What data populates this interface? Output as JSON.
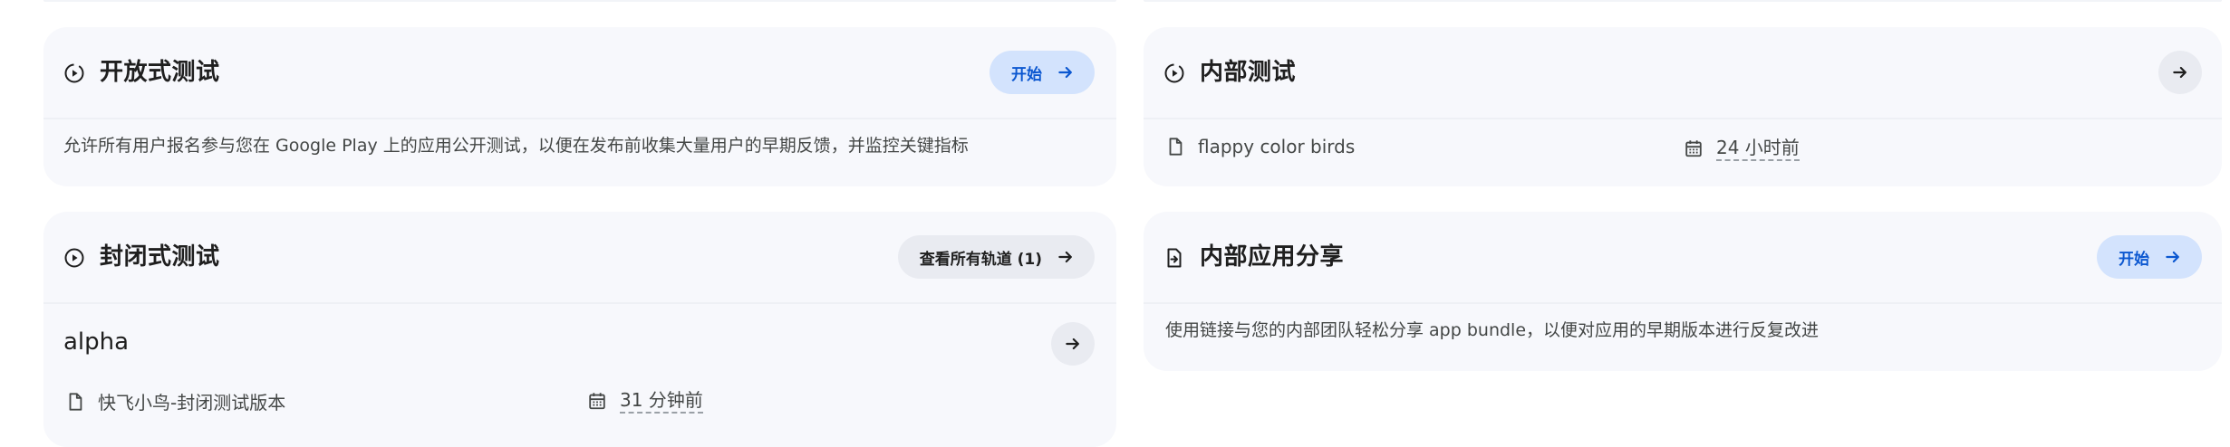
{
  "open_testing": {
    "title": "开放式测试",
    "action_label": "开始",
    "description": "允许所有用户报名参与您在 Google Play 上的应用公开测试，以便在发布前收集大量用户的早期反馈，并监控关键指标"
  },
  "internal_testing": {
    "title": "内部测试",
    "file_name": "flappy color birds",
    "time": "24 小时前"
  },
  "closed_testing": {
    "title": "封闭式测试",
    "action_label": "查看所有轨道 (1)",
    "track": {
      "name": "alpha",
      "file_name": "快飞小鸟-封闭测试版本",
      "time": "31 分钟前"
    }
  },
  "internal_app_sharing": {
    "title": "内部应用分享",
    "action_label": "开始",
    "description": "使用链接与您的内部团队轻松分享 app bundle，以便对应用的早期版本进行反复改进"
  },
  "colors": {
    "accent": "#0b57d0",
    "accent_bg": "#d3e3fd",
    "card_bg": "#f7f8fc"
  },
  "icons": [
    "play-circle-icon",
    "file-icon",
    "calendar-icon",
    "arrow-right-icon",
    "share-file-icon"
  ]
}
